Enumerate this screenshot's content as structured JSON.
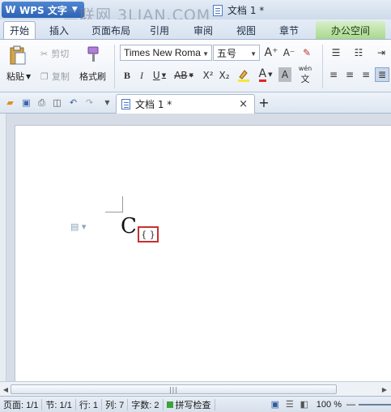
{
  "title_bar": {
    "app_name": "WPS 文字",
    "doc_title": "文档 1 *",
    "watermark": "二联网 3LIAN.COM"
  },
  "tabs": [
    {
      "label": "开始",
      "active": true
    },
    {
      "label": "插入"
    },
    {
      "label": "页面布局"
    },
    {
      "label": "引用"
    },
    {
      "label": "审阅"
    },
    {
      "label": "视图"
    },
    {
      "label": "章节"
    },
    {
      "label": "办公空间",
      "highlight": true
    }
  ],
  "ribbon": {
    "cut": "剪切",
    "paste": "粘贴",
    "copy": "复制",
    "format_painter": "格式刷",
    "font_name": "Times New Roma",
    "font_size": "五号",
    "bold": "B",
    "italic": "I",
    "underline": "U",
    "strike": "AB",
    "superscript": "X²",
    "subscript": "X₂",
    "font_color": "A",
    "char_shade": "A",
    "phonetic": "wén",
    "grow": "A⁺",
    "shrink": "A⁻"
  },
  "doc_tab": {
    "label": "文档 1 *",
    "close": "×",
    "new": "+"
  },
  "document": {
    "content_char": "C",
    "equation_placeholder": "{ }"
  },
  "status_bar": {
    "page": "页面: 1/1",
    "section": "节: 1/1",
    "row": "行: 1",
    "col": "列: 7",
    "words": "字数: 2",
    "spell": "拼写检查",
    "zoom": "100 %",
    "zoom_out": "—"
  },
  "colors": {
    "accent_blue": "#2d63b4",
    "highlight_green": "#a9d98e",
    "selection_red": "#c8312e"
  }
}
